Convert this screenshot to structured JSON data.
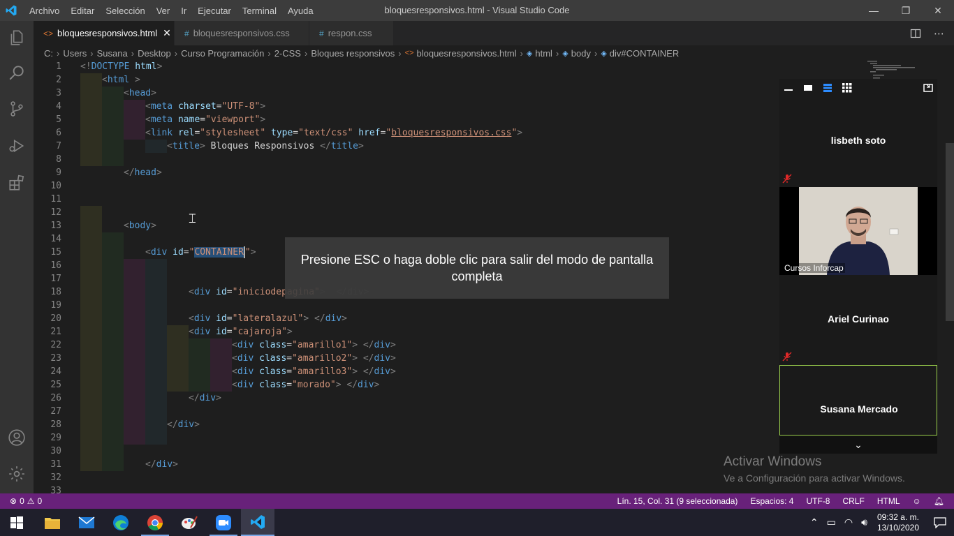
{
  "window": {
    "title": "bloquesresponsivos.html - Visual Studio Code",
    "menu": [
      "Archivo",
      "Editar",
      "Selección",
      "Ver",
      "Ir",
      "Ejecutar",
      "Terminal",
      "Ayuda"
    ],
    "controls": {
      "minimize": "—",
      "restore": "❐",
      "close": "✕"
    }
  },
  "colors": {
    "statusbar": "#68217a",
    "editor_bg": "#1e1e1e",
    "speaker_border": "#9bd14c"
  },
  "tabs": [
    {
      "label": "bloquesresponsivos.html",
      "icon": "<>",
      "active": true
    },
    {
      "label": "bloquesresponsivos.css",
      "icon": "#",
      "active": false
    },
    {
      "label": "respon.css",
      "icon": "#",
      "active": false
    }
  ],
  "breadcrumb": [
    "C:",
    "Users",
    "Susana",
    "Desktop",
    "Curso Programación",
    "2-CSS",
    "Bloques responsivos",
    "bloquesresponsivos.html",
    "html",
    "body",
    "div#CONTAINER"
  ],
  "editor": {
    "line_numbers": [
      "1",
      "2",
      "3",
      "4",
      "5",
      "6",
      "7",
      "8",
      "9",
      "10",
      "11",
      "12",
      "13",
      "14",
      "15",
      "16",
      "17",
      "18",
      "19",
      "20",
      "21",
      "22",
      "23",
      "24",
      "25",
      "26",
      "27",
      "28",
      "29",
      "30",
      "31",
      "32",
      "33"
    ]
  },
  "toast": {
    "message": "Presione ESC o haga doble clic para salir del modo de pantalla completa"
  },
  "zoom": {
    "participants": [
      {
        "name": "lisbeth soto",
        "muted": true
      },
      {
        "name": "Cursos Inforcap",
        "video": true
      },
      {
        "name": "Ariel Curinao",
        "muted": true
      },
      {
        "name": "Susana Mercado",
        "speaking": true
      }
    ],
    "more_icon": "chevron-down-icon"
  },
  "watermark": {
    "title": "Activar Windows",
    "subtitle": "Ve a Configuración para activar Windows."
  },
  "statusbar": {
    "errors": "0",
    "warnings": "0",
    "position": "Lín. 15, Col. 31 (9 seleccionada)",
    "spaces": "Espacios: 4",
    "encoding": "UTF-8",
    "eol": "CRLF",
    "language": "HTML"
  },
  "taskbar": {
    "time": "09:32 a. m.",
    "date": "13/10/2020",
    "apps": [
      "start-icon",
      "file-explorer-icon",
      "mail-icon",
      "edge-icon",
      "chrome-icon",
      "paint-icon",
      "zoom-icon",
      "vscode-icon"
    ]
  }
}
